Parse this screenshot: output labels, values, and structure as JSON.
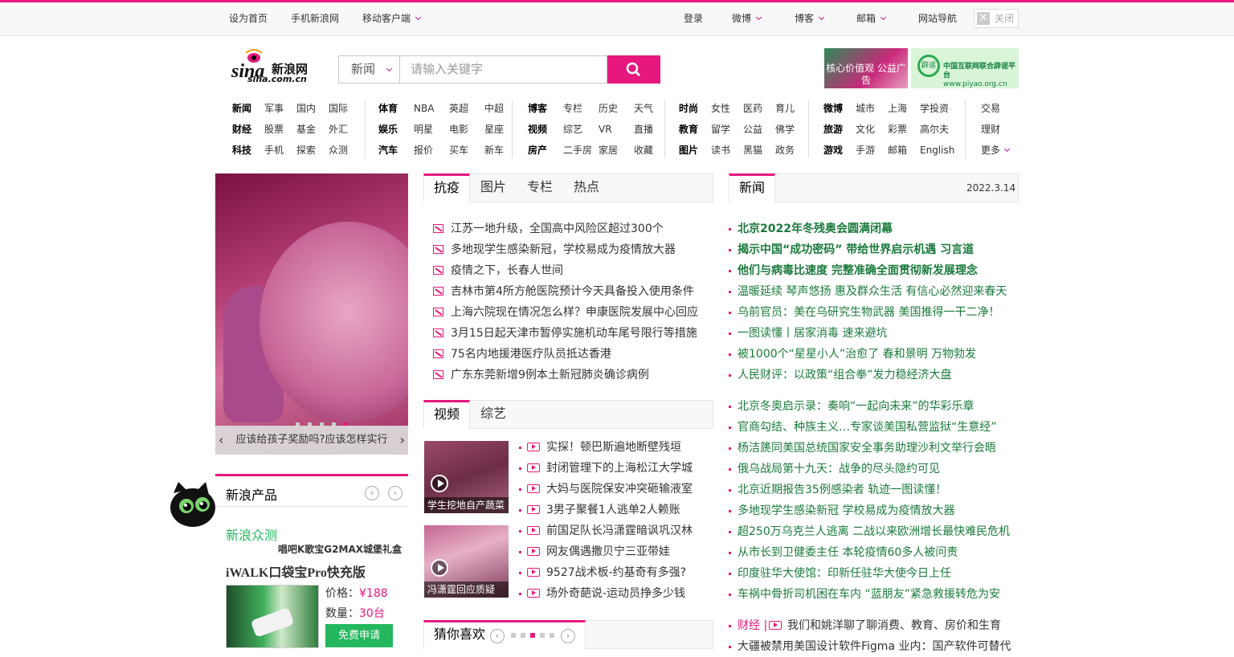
{
  "topbar": {
    "set_home": "设为首页",
    "mobile_sina": "手机新浪网",
    "mobile_client": "移动客户端",
    "login": "登录",
    "weibo": "微博",
    "blog": "博客",
    "mail": "邮箱",
    "site_nav": "网站导航",
    "close": "关闭"
  },
  "header": {
    "logo_text": "sina新浪网",
    "logo_domain": "sina.com.cn",
    "search_category": "新闻",
    "search_placeholder": "请输入关键字",
    "ad1": "核心价值观 公益广告",
    "ad2": "中国互联网联合辟谣平台",
    "ad2_badge": "辟谣",
    "ad2_url": "www.piyao.org.cn"
  },
  "nav": {
    "col1": [
      [
        "新闻",
        "军事",
        "国内",
        "国际"
      ],
      [
        "财经",
        "股票",
        "基金",
        "外汇"
      ],
      [
        "科技",
        "手机",
        "探索",
        "众测"
      ]
    ],
    "col2": [
      [
        "体育",
        "NBA",
        "英超",
        "中超"
      ],
      [
        "娱乐",
        "明星",
        "电影",
        "星座"
      ],
      [
        "汽车",
        "报价",
        "买车",
        "新车"
      ]
    ],
    "col3": [
      [
        "博客",
        "专栏",
        "历史",
        "天气"
      ],
      [
        "视频",
        "综艺",
        "VR",
        "直播"
      ],
      [
        "房产",
        "二手房",
        "家居",
        "收藏"
      ]
    ],
    "col4": [
      [
        "时尚",
        "女性",
        "医药",
        "育儿"
      ],
      [
        "教育",
        "留学",
        "公益",
        "佛学"
      ],
      [
        "图片",
        "读书",
        "黑猫",
        "政务"
      ]
    ],
    "col5": [
      [
        "微博",
        "城市",
        "上海",
        "学投资"
      ],
      [
        "旅游",
        "文化",
        "彩票",
        "高尔夫"
      ],
      [
        "游戏",
        "手游",
        "邮箱",
        "English"
      ]
    ],
    "col6": [
      [
        "交易"
      ],
      [
        "理财"
      ],
      [
        "更多"
      ]
    ]
  },
  "carousel": {
    "caption": "应该给孩子奖励吗?应该怎样实行"
  },
  "products": {
    "title": "新浪产品",
    "brand": "新浪众测",
    "subtitle": "唱吧K歌宝G2MAX城堡礼盒",
    "product_name": "iWALK口袋宝Pro快充版",
    "price_label": "价格：",
    "price": "¥188",
    "qty_label": "数量：",
    "qty": "30台",
    "apply": "免费申请"
  },
  "mid_tabs": [
    "抗疫",
    "图片",
    "专栏",
    "热点"
  ],
  "mid_news": [
    "江苏一地升级，全国高中风险区超过300个",
    "多地现学生感染新冠，学校易成为疫情放大器",
    "疫情之下，长春人世间",
    "吉林市第4所方舱医院预计今天具备投入使用条件",
    "上海六院现在情况怎么样？申康医院发展中心回应",
    "3月15日起天津市暂停实施机动车尾号限行等措施",
    "75名内地援港医疗队员抵达香港",
    "广东东莞新增9例本土新冠肺炎确诊病例"
  ],
  "video_tabs": [
    "视频",
    "综艺"
  ],
  "video_thumbs": [
    "学生挖地自产蔬菜",
    "冯潇霆回应质疑"
  ],
  "video_news": [
    "实探！顿巴斯遍地断壁残垣",
    "封闭管理下的上海松江大学城",
    "大妈与医院保安冲突砸输液室",
    "3男子聚餐1人逃单2人赖账",
    "前国足队长冯潇霆暗讽巩汉林",
    "网友偶遇撒贝宁三亚带娃",
    "9527战术板-约基奇有多强?",
    "场外奇葩说-运动员挣多少钱"
  ],
  "guess": {
    "title": "猜你喜欢"
  },
  "right": {
    "tab": "新闻",
    "date": "2022.3.14",
    "headlines": [
      "北京2022年冬残奥会圆满闭幕",
      "揭示中国“成功密码” 带给世界启示机遇 习言道",
      "他们与病毒比速度 完整准确全面贯彻新发展理念"
    ],
    "news1": [
      "温暖延续 琴声悠扬 惠及群众生活 有信心必然迎来春天",
      "乌前官员：美在乌研究生物武器 美国推得一干二净！",
      "一图读懂丨居家消毒 速来避坑",
      "被1000个“星星小人”治愈了 春和景明 万物勃发",
      "人民财评：以政策“组合拳”发力稳经济大盘"
    ],
    "news2": [
      "北京冬奥启示录：奏响“一起向未来”的华彩乐章",
      "官商勾结、种族主义…专家谈美国私营监狱“生意经”",
      "杨洁篪同美国总统国家安全事务助理沙利文举行会晤",
      "俄乌战局第十九天：战争的尽头隐约可见",
      "北京近期报告35例感染者 轨迹一图读懂！",
      "多地现学生感染新冠 学校易成为疫情放大器",
      "超250万乌克兰人逃离 二战以来欧洲增长最快难民危机",
      "从市长到卫健委主任 本轮疫情60多人被问责",
      "印度驻华大使馆：印新任驻华大使今日上任",
      "车祸中骨折司机困在车内 “蓝朋友”紧急救援转危为安"
    ],
    "finance_label": "财经 |",
    "finance_item": "我们和姚洋聊了聊消费、教育、房价和生育",
    "last_item": "大疆被禁用美国设计软件Figma 业内：国产软件可替代"
  }
}
